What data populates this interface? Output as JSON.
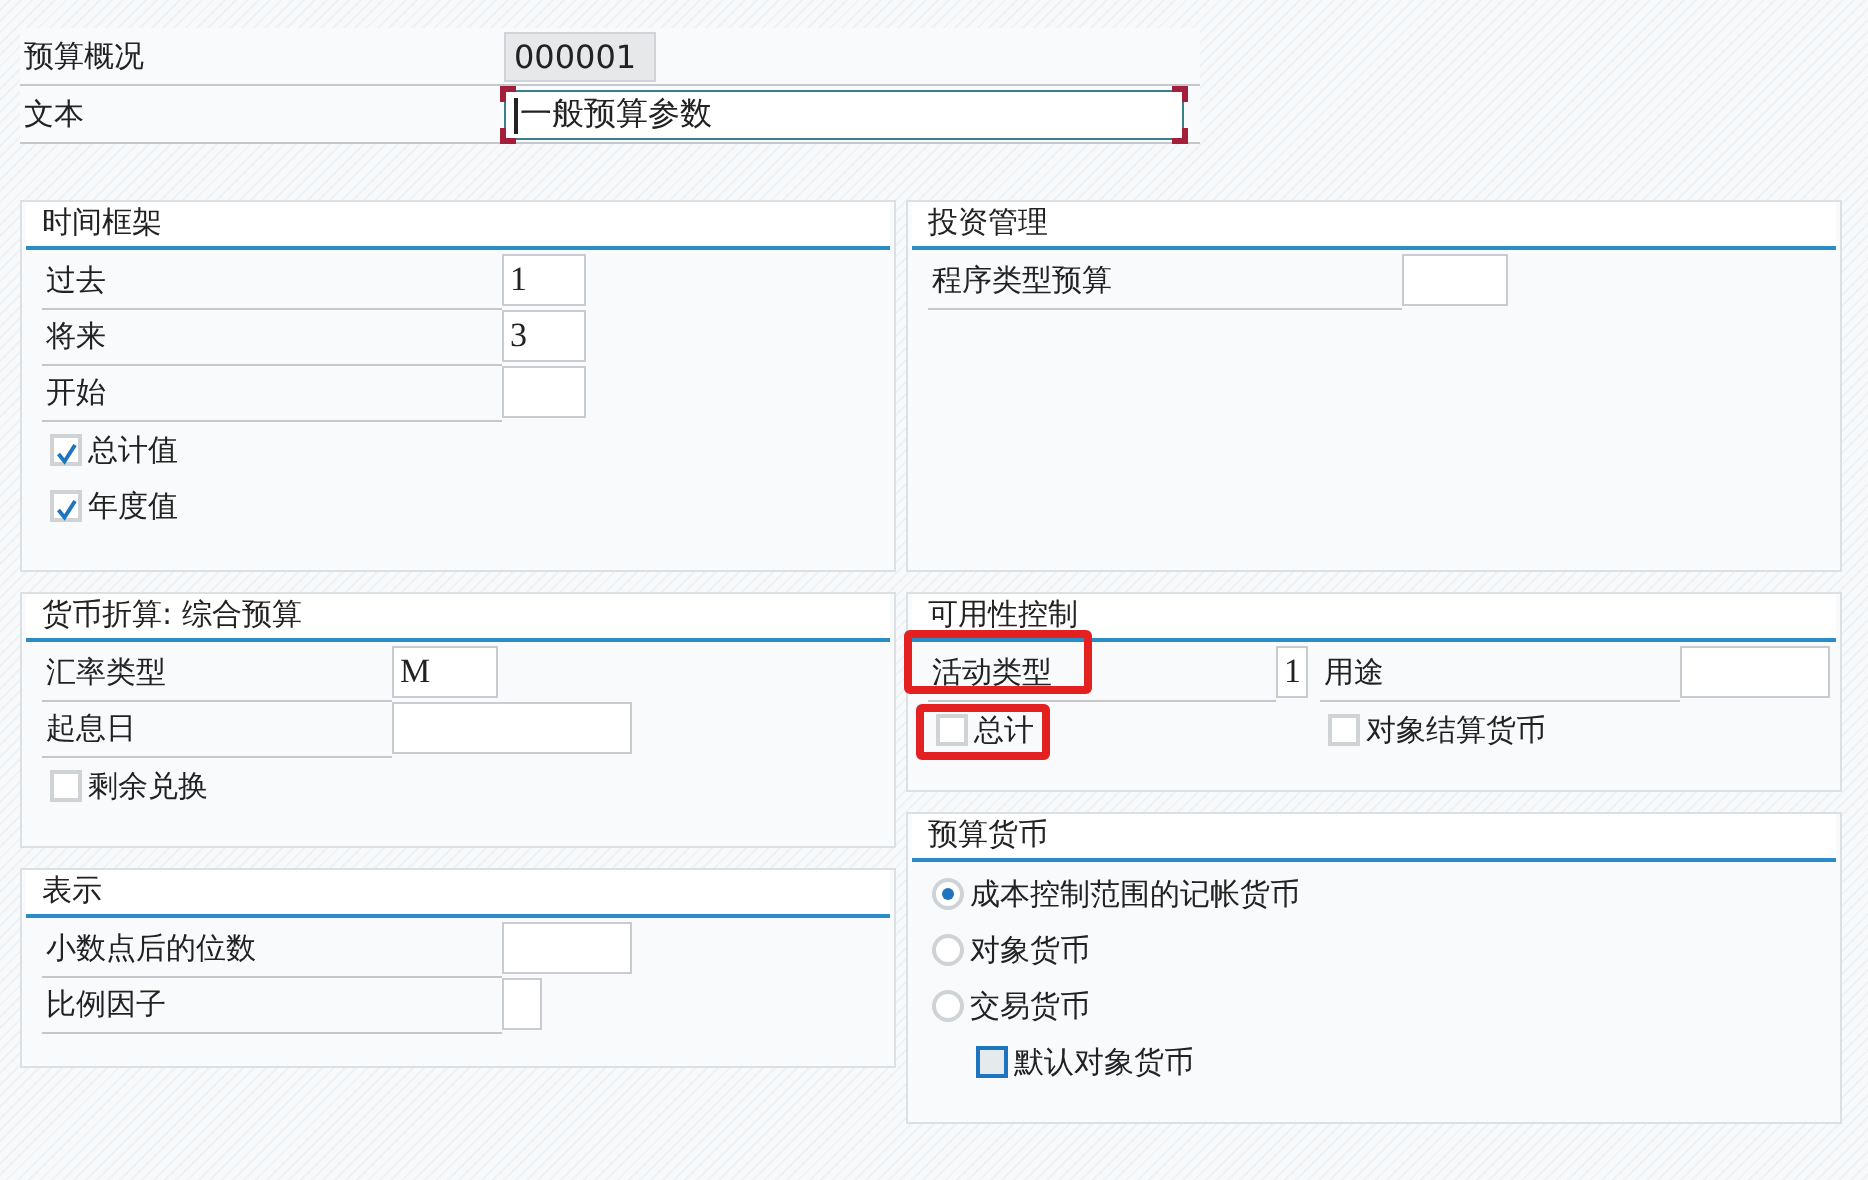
{
  "header": [
    {
      "label": "预算概况",
      "value": "000001",
      "readonly": true,
      "focused": false
    },
    {
      "label": "文本",
      "value": "一般预算参数",
      "readonly": false,
      "focused": true
    }
  ],
  "left_panels": [
    {
      "title": "时间框架",
      "items": [
        {
          "kind": "field",
          "label": "过去",
          "value": "1"
        },
        {
          "kind": "field",
          "label": "将来",
          "value": "3"
        },
        {
          "kind": "field",
          "label": "开始"
        },
        {
          "kind": "checkbox",
          "label": "总计值",
          "checked": true
        },
        {
          "kind": "checkbox",
          "label": "年度值",
          "checked": true
        }
      ]
    },
    {
      "title": "货币折算: 综合预算",
      "items": [
        {
          "kind": "field",
          "label": "汇率类型",
          "value": "M"
        },
        {
          "kind": "field",
          "label": "起息日"
        },
        {
          "kind": "checkbox",
          "label": "剩余兑换",
          "checked": false
        }
      ]
    },
    {
      "title": "表示",
      "items": [
        {
          "kind": "field",
          "label": "小数点后的位数"
        },
        {
          "kind": "field",
          "label": "比例因子"
        }
      ]
    }
  ],
  "right_panels": [
    {
      "title": "投资管理",
      "items": [
        {
          "kind": "field",
          "label": "程序类型预算"
        }
      ]
    },
    {
      "title": "可用性控制",
      "items": [
        {
          "kind": "field",
          "label": "活动类型",
          "value": "1",
          "highlighted": true
        },
        {
          "kind": "field",
          "label": "用途",
          "highlighted": false
        },
        {
          "kind": "checkbox",
          "label": "总计",
          "checked": false,
          "highlighted": true
        },
        {
          "kind": "checkbox",
          "label": "对象结算货币",
          "checked": false,
          "highlighted": false
        }
      ]
    },
    {
      "title": "预算货币",
      "items": [
        {
          "kind": "radio",
          "label": "成本控制范围的记帐货币",
          "selected": true
        },
        {
          "kind": "radio",
          "label": "对象货币",
          "selected": false
        },
        {
          "kind": "radio",
          "label": "交易货币",
          "selected": false,
          "children": [
            {
              "kind": "checkbox",
              "label": "默认对象货币",
              "checked": false,
              "focused": true
            }
          ]
        }
      ]
    }
  ]
}
